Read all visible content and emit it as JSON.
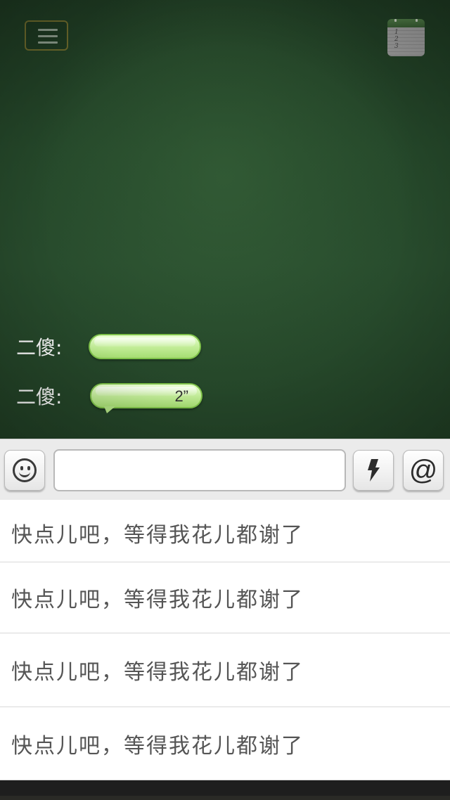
{
  "top_bar": {
    "menu_icon": "hamburger-icon",
    "notepad_icon": "notepad-icon",
    "notepad_lines": [
      "1",
      "2",
      "3"
    ]
  },
  "messages": [
    {
      "sender": "二傻:",
      "duration": ""
    },
    {
      "sender": "二傻:",
      "duration": "2”"
    }
  ],
  "input_bar": {
    "emoji_icon": "smiley-icon",
    "text_value": "",
    "quick_icon": "lightning-icon",
    "at_label": "@"
  },
  "phrases": [
    "快点儿吧，等得我花儿都谢了",
    "快点儿吧，等得我花儿都谢了",
    "快点儿吧，等得我花儿都谢了",
    "快点儿吧，等得我花儿都谢了"
  ],
  "colors": {
    "chalkboard": "#25482a",
    "bubble": "#c4ee9a",
    "bubble_border": "#7fc24a"
  }
}
